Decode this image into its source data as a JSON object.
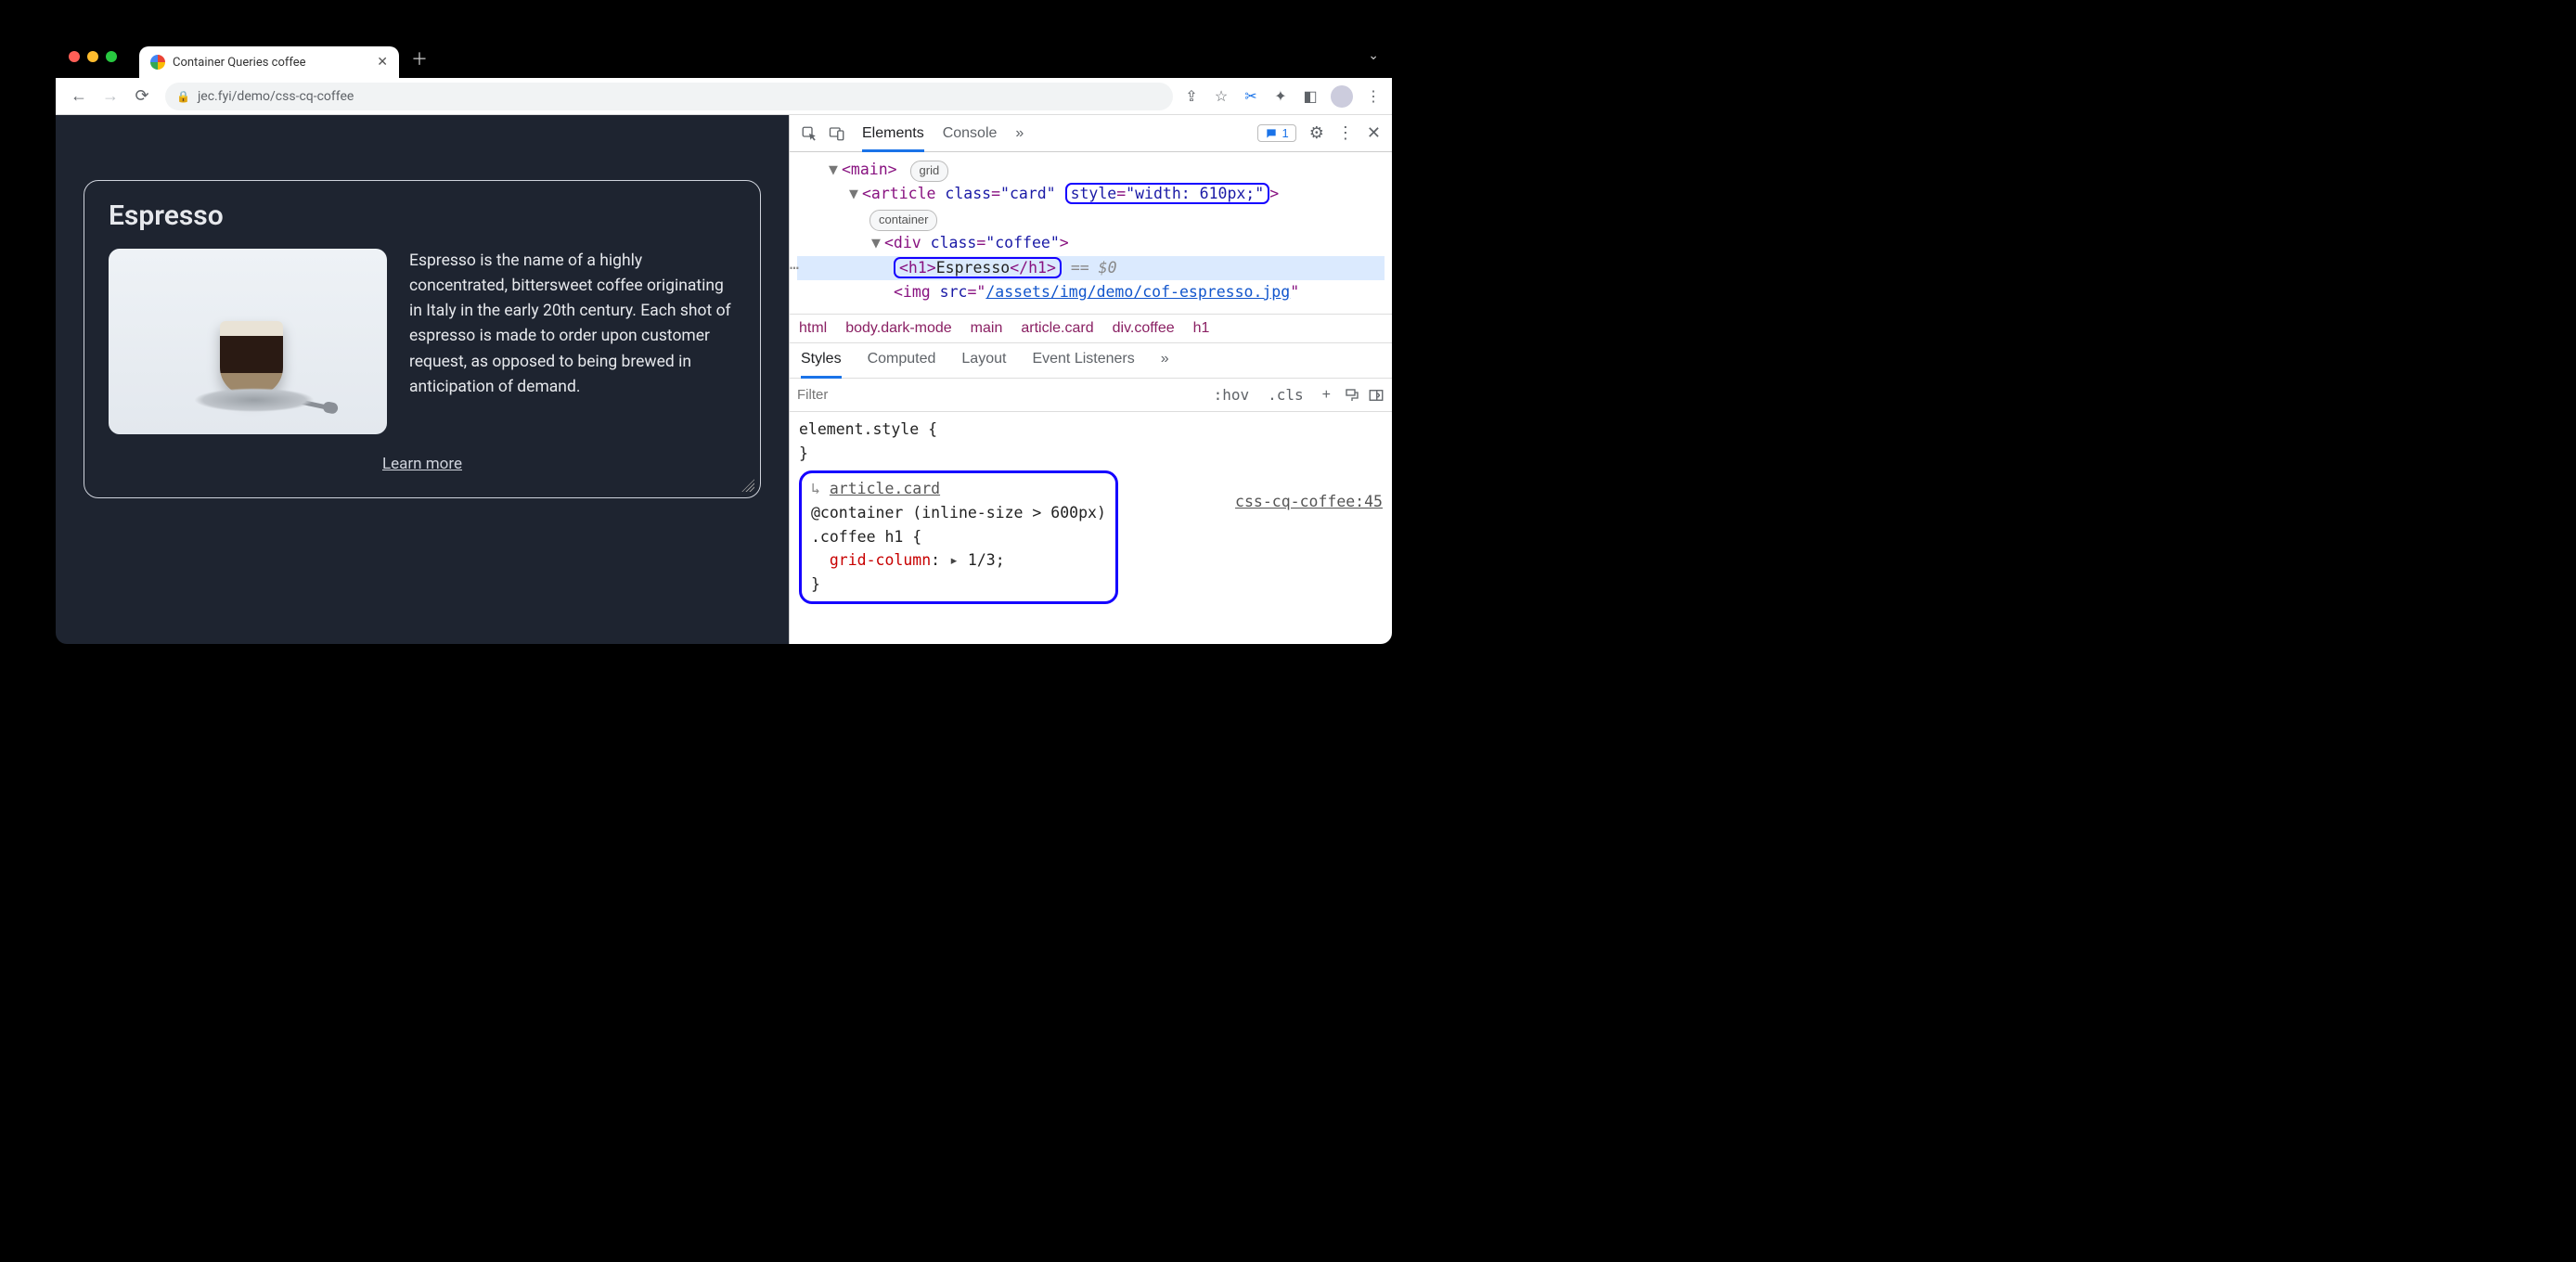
{
  "window": {
    "tab_title": "Container Queries coffee",
    "menu_glyph": "⌄"
  },
  "toolbar": {
    "back": "←",
    "fwd": "→",
    "reload": "⟳",
    "url_host": "jec.fyi",
    "url_path": "/demo/css-cq-coffee",
    "share": "⇪",
    "star": "☆",
    "scissors": "✂",
    "puzzle": "✦",
    "panel": "◧",
    "dots": "⋮"
  },
  "page": {
    "title": "Espresso",
    "desc": "Espresso is the name of a highly concentrated, bittersweet coffee originating in Italy in the early 20th century. Each shot of espresso is made to order upon customer request, as opposed to being brewed in anticipation of demand.",
    "learn": "Learn more"
  },
  "devtools": {
    "tabs": {
      "elements": "Elements",
      "console": "Console",
      "more": "»"
    },
    "issues_count": "1",
    "dom": {
      "l1_open": "<main>",
      "badge_grid": "grid",
      "l2_open_a": "<article ",
      "l2_class": "class",
      "l2_classv": "\"card\"",
      "l2_style": "style",
      "l2_stylev": "\"width: 610px;\"",
      "l2_close": ">",
      "badge_container": "container",
      "l3_open": "<div ",
      "l3_class": "class",
      "l3_classv": "\"coffee\"",
      "l3_close": ">",
      "h1_open": "<h1>",
      "h1_text": "Espresso",
      "h1_close": "</h1>",
      "eq": " == ",
      "dollar": "$0",
      "img_open": "<img ",
      "img_src": "src",
      "img_val": "/assets/img/demo/cof-espresso.jpg",
      "img_end": "\""
    },
    "crumbs": [
      "html",
      "body.dark-mode",
      "main",
      "article.card",
      "div.coffee",
      "h1"
    ],
    "sp_tabs": {
      "styles": "Styles",
      "computed": "Computed",
      "layout": "Layout",
      "listeners": "Event Listeners",
      "more": "»"
    },
    "sp_bar": {
      "filter_ph": "Filter",
      "hov": ":hov",
      "cls": ".cls",
      "plus": "+"
    },
    "styles": {
      "elstyle": "element.style {",
      "close": "}",
      "ancestor": "article.card",
      "cq": "@container (inline-size > 600px)",
      "sel": ".coffee h1 {",
      "prop": "grid-column",
      "val": "1/3",
      "src": "css-cq-coffee:45"
    }
  }
}
